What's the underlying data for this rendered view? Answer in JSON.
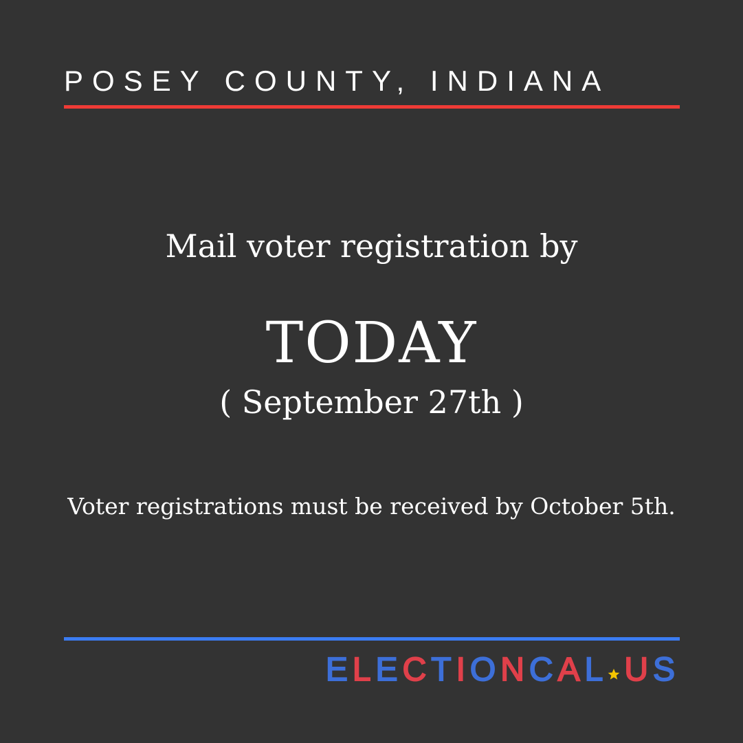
{
  "header": {
    "county": "POSEY COUNTY, INDIANA"
  },
  "message": {
    "line1": "Mail voter registration by",
    "headline": "TODAY",
    "date": "( September 27th )",
    "note": "Voter registrations must be received by October 5th."
  },
  "brand": {
    "text_primary": "ELECTIONCAL",
    "text_secondary": "US",
    "star_icon": "star-icon"
  },
  "colors": {
    "background": "#333333",
    "accent_red": "#ef3b36",
    "accent_blue": "#3b7cf2",
    "brand_red": "#e0404a",
    "brand_blue": "#3d6fd8",
    "star": "#f4c400"
  }
}
